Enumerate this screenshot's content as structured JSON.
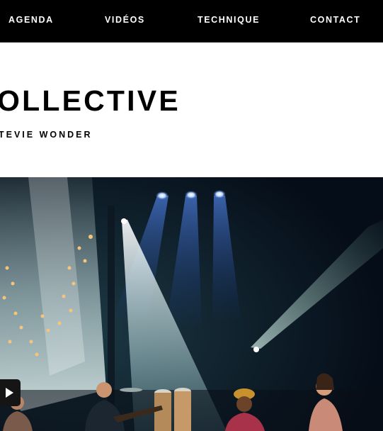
{
  "nav": {
    "agenda": "AGENDA",
    "videos": "VIDÉOS",
    "technique": "TECHNIQUE",
    "contact": "CONTACT"
  },
  "hero": {
    "title": "OLLECTIVE",
    "subtitle": "TEVIE WONDER"
  },
  "media": {
    "play_icon": "play-icon"
  },
  "colors": {
    "nav_bg": "#000000",
    "nav_text": "#ffffff",
    "stage_bg": "#071424",
    "beam": "#cfe6e8"
  }
}
